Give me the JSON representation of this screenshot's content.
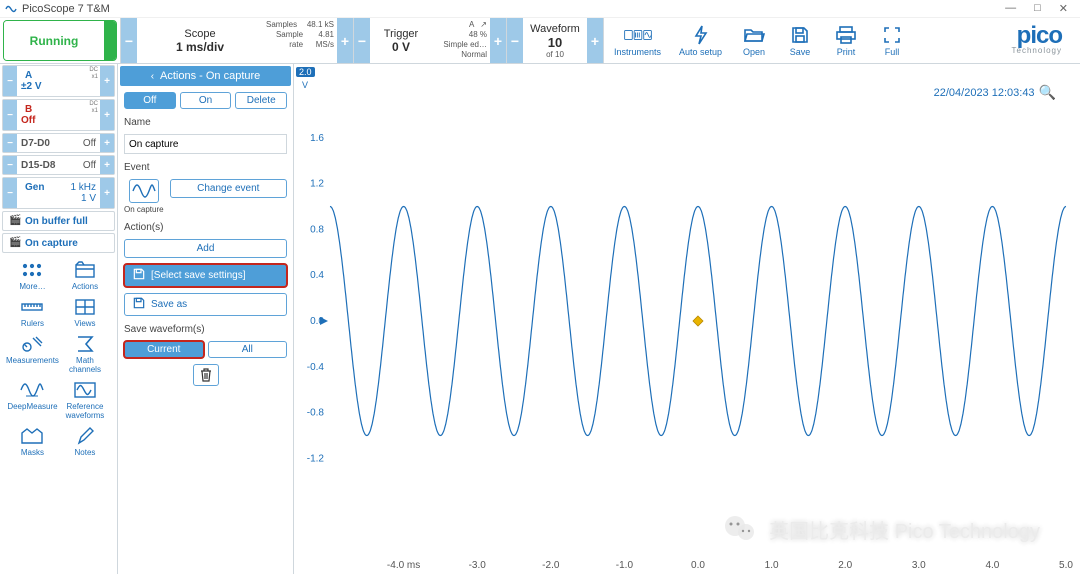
{
  "window": {
    "app_title": "PicoScope 7 T&M",
    "controls": {
      "min": "—",
      "max": "□",
      "close": "✕"
    }
  },
  "topstrip": {
    "running_label": "Running",
    "scope": {
      "title": "Scope",
      "value": "1 ms/div",
      "samples_label": "Samples",
      "samples_value": "48.1 kS",
      "rate_label": "Sample rate",
      "rate_value": "4.81 MS/s"
    },
    "trigger": {
      "title": "Trigger",
      "value": "0 V",
      "ch": "A",
      "slope": "↗",
      "percent": "48 %",
      "mode1": "Simple ed…",
      "mode2": "Normal"
    },
    "waveform": {
      "title": "Waveform",
      "num": "10",
      "of": "of 10"
    },
    "toolbar": [
      {
        "k": "instruments",
        "label": "Instruments"
      },
      {
        "k": "auto",
        "label": "Auto setup"
      },
      {
        "k": "open",
        "label": "Open"
      },
      {
        "k": "save",
        "label": "Save"
      },
      {
        "k": "print",
        "label": "Print"
      },
      {
        "k": "full",
        "label": "Full"
      }
    ],
    "logo": {
      "main": "pico",
      "sub": "Technology"
    }
  },
  "channels": {
    "A": {
      "label": "A",
      "range": "±2 V",
      "tag1": "DC",
      "tag2": "x1"
    },
    "B": {
      "label": "B",
      "range": "Off",
      "tag1": "DC",
      "tag2": "x1"
    },
    "D70": {
      "label": "D7-D0",
      "state": "Off"
    },
    "D158": {
      "label": "D15-D8",
      "state": "Off"
    },
    "Gen": {
      "label": "Gen",
      "freq": "1 kHz",
      "volt": "1 V"
    },
    "buffer_full_label": "On buffer full",
    "on_capture_label": "On capture"
  },
  "icon_grid": [
    {
      "k": "more",
      "label": "More…"
    },
    {
      "k": "actions",
      "label": "Actions"
    },
    {
      "k": "rulers",
      "label": "Rulers"
    },
    {
      "k": "views",
      "label": "Views"
    },
    {
      "k": "meas",
      "label": "Measurements"
    },
    {
      "k": "math",
      "label": "Math\nchannels"
    },
    {
      "k": "deep",
      "label": "DeepMeasure"
    },
    {
      "k": "ref",
      "label": "Reference\nwaveforms"
    },
    {
      "k": "masks",
      "label": "Masks"
    },
    {
      "k": "notes",
      "label": "Notes"
    }
  ],
  "actions_panel": {
    "header": "Actions - On capture",
    "tabs": {
      "off": "Off",
      "on": "On",
      "delete": "Delete"
    },
    "name_label": "Name",
    "name_value": "On capture",
    "event_label": "Event",
    "event_caption": "On capture",
    "change_event_label": "Change event",
    "actions_label": "Action(s)",
    "add_label": "Add",
    "select_save_label": "[Select save settings]",
    "save_as_label": "Save as",
    "save_waveforms_label": "Save waveform(s)",
    "current_label": "Current",
    "all_label": "All"
  },
  "chart_meta": {
    "badge": "2.0",
    "unit": "V",
    "timestamp": "22/04/2023 12:03:43"
  },
  "chart_data": {
    "type": "line",
    "title": "",
    "xlabel": "ms",
    "ylabel": "V",
    "xlim": [
      -5.0,
      5.0
    ],
    "ylim": [
      -2.0,
      2.0
    ],
    "y_ticks": [
      -1.2,
      -0.8,
      -0.4,
      0.0,
      0.4,
      0.8,
      1.2,
      1.6
    ],
    "x_ticks": [
      -4.0,
      -3.0,
      -2.0,
      -1.0,
      0.0,
      1.0,
      2.0,
      3.0,
      4.0,
      5.0
    ],
    "x_tick_labels": [
      "-4.0 ms",
      "-3.0",
      "-2.0",
      "-1.0",
      "0.0",
      "1.0",
      "2.0",
      "3.0",
      "4.0",
      "5.0"
    ],
    "series": [
      {
        "name": "A",
        "color": "#1e6fb8",
        "function": "sine",
        "amplitude": 1.0,
        "frequency_hz": 1000,
        "period_ms": 1.0,
        "phase_deg": 90
      }
    ],
    "marker": {
      "x": 0.0,
      "y": 0.0,
      "color": "#e9b400"
    }
  },
  "overlay": {
    "text": "英国比克科技 Pico Technology"
  }
}
